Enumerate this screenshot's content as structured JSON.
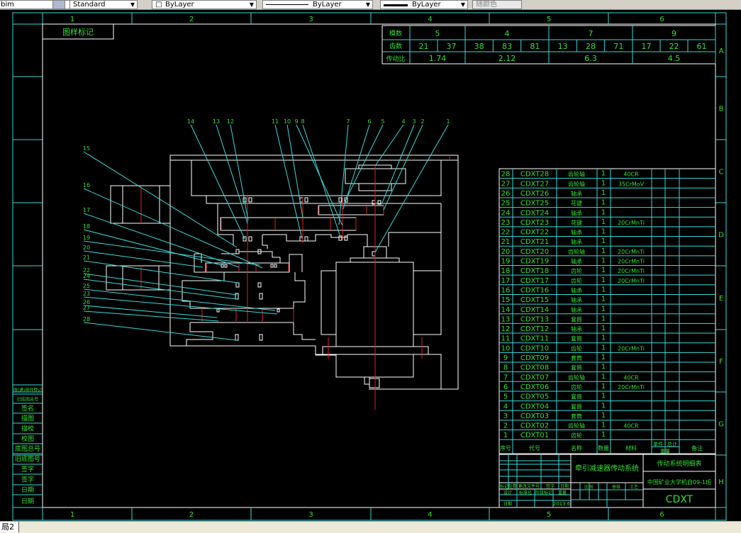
{
  "toolbar": {
    "dim_style": "bim",
    "text_style": "Standard",
    "layer_color": "ByLayer",
    "linetype": "ByLayer",
    "lineweight": "ByLayer",
    "plot_style": "随颜色"
  },
  "layout_tab": "局2",
  "colors": {
    "frame": "#38d8d8",
    "text": "#33e033",
    "geometry": "#ffffff",
    "centerline": "#e02020"
  },
  "border": {
    "columns": [
      "1",
      "2",
      "3",
      "4",
      "5",
      "6"
    ],
    "rows": [
      "A",
      "B",
      "C",
      "D",
      "E",
      "F",
      "G",
      "H"
    ],
    "top_left_label": "图样标记"
  },
  "gear_table": {
    "row_labels": [
      "模数",
      "齿数",
      "传动比"
    ],
    "groups": [
      {
        "module": "5",
        "teeth": [
          "21",
          "37"
        ],
        "ratio": "1.74"
      },
      {
        "module": "4",
        "teeth": [
          "38",
          "83",
          "81"
        ],
        "ratio": "2.12"
      },
      {
        "module": "7",
        "teeth": [
          "13",
          "28",
          "71"
        ],
        "ratio": "6.3"
      },
      {
        "module": "9",
        "teeth": [
          "17",
          "22",
          "61"
        ],
        "ratio": "4.5"
      }
    ]
  },
  "callouts_top": [
    "14",
    "13",
    "12",
    "11",
    "10",
    "9",
    "8",
    "7",
    "6",
    "5",
    "4",
    "3",
    "2",
    "1"
  ],
  "callouts_left": [
    "15",
    "16",
    "17",
    "18",
    "19",
    "20",
    "21",
    "22",
    "24",
    "25",
    "23",
    "26",
    "27",
    "28"
  ],
  "bom": {
    "headers": [
      "序号",
      "代号",
      "名称",
      "数量",
      "材料",
      "单件",
      "总计",
      "重量",
      "备注"
    ],
    "rows": [
      {
        "no": "28",
        "code": "CDXT28",
        "name": "齿轮轴",
        "qty": "1",
        "material": "40CR"
      },
      {
        "no": "27",
        "code": "CDXT27",
        "name": "齿轮轴",
        "qty": "1",
        "material": "35CrMoV"
      },
      {
        "no": "26",
        "code": "CDXT26",
        "name": "轴承",
        "qty": "1",
        "material": ""
      },
      {
        "no": "25",
        "code": "CDXT25",
        "name": "花键",
        "qty": "1",
        "material": ""
      },
      {
        "no": "24",
        "code": "CDXT24",
        "name": "轴承",
        "qty": "1",
        "material": ""
      },
      {
        "no": "23",
        "code": "CDXT23",
        "name": "花键",
        "qty": "1",
        "material": "20CrMnTi"
      },
      {
        "no": "22",
        "code": "CDXT22",
        "name": "轴承",
        "qty": "1",
        "material": ""
      },
      {
        "no": "21",
        "code": "CDXT21",
        "name": "轴承",
        "qty": "1",
        "material": ""
      },
      {
        "no": "20",
        "code": "CDXT20",
        "name": "齿轮轴",
        "qty": "1",
        "material": "20CrMnTi"
      },
      {
        "no": "19",
        "code": "CDXT19",
        "name": "轴承",
        "qty": "1",
        "material": "20CrMnTi"
      },
      {
        "no": "18",
        "code": "CDXT18",
        "name": "齿轮",
        "qty": "1",
        "material": "20CrMnTi"
      },
      {
        "no": "17",
        "code": "CDXT17",
        "name": "齿轮",
        "qty": "1",
        "material": "20CrMnTi"
      },
      {
        "no": "16",
        "code": "CDXT16",
        "name": "轴承",
        "qty": "1",
        "material": ""
      },
      {
        "no": "15",
        "code": "CDXT15",
        "name": "轴承",
        "qty": "1",
        "material": ""
      },
      {
        "no": "14",
        "code": "CDXT14",
        "name": "轴承",
        "qty": "1",
        "material": ""
      },
      {
        "no": "13",
        "code": "CDXT13",
        "name": "套筒",
        "qty": "1",
        "material": ""
      },
      {
        "no": "12",
        "code": "CDXT12",
        "name": "轴承",
        "qty": "1",
        "material": ""
      },
      {
        "no": "11",
        "code": "CDXT11",
        "name": "套筒",
        "qty": "1",
        "material": ""
      },
      {
        "no": "10",
        "code": "CDXT10",
        "name": "齿轮",
        "qty": "1",
        "material": "20CrMnTi"
      },
      {
        "no": "9",
        "code": "CDXT09",
        "name": "套筒",
        "qty": "1",
        "material": ""
      },
      {
        "no": "8",
        "code": "CDXT08",
        "name": "套筒",
        "qty": "1",
        "material": ""
      },
      {
        "no": "7",
        "code": "CDXT07",
        "name": "齿轮轴",
        "qty": "1",
        "material": "40CR"
      },
      {
        "no": "6",
        "code": "CDXT06",
        "name": "齿轮",
        "qty": "1",
        "material": "20CrMnTi"
      },
      {
        "no": "5",
        "code": "CDXT05",
        "name": "套筒",
        "qty": "1",
        "material": ""
      },
      {
        "no": "4",
        "code": "CDXT04",
        "name": "套筒",
        "qty": "1",
        "material": ""
      },
      {
        "no": "3",
        "code": "CDXT03",
        "name": "套筒",
        "qty": "1",
        "material": ""
      },
      {
        "no": "2",
        "code": "CDXT02",
        "name": "齿轮轴",
        "qty": "1",
        "material": "40CR"
      },
      {
        "no": "1",
        "code": "CDXT01",
        "name": "齿轮",
        "qty": "1",
        "material": ""
      }
    ]
  },
  "title_block": {
    "drawing_title": "牵引减速器传动系统",
    "sheet_title": "传动系统明细表",
    "organization": "中国矿业大学机自09-1班",
    "drawing_code": "CDXT",
    "date": "2013.6",
    "small_labels": [
      "标记",
      "处数",
      "更改文件号",
      "签字",
      "日期",
      "设计",
      "标准化",
      "阶段标记",
      "重量",
      "比例",
      "审核",
      "工艺",
      "日期"
    ]
  },
  "side_strip": [
    "借(通)用件登记",
    "旧底图总号",
    "签名",
    "描图",
    "描校",
    "校图",
    "底图总号",
    "旧底图号",
    "签字",
    "签字",
    "日期",
    "日期"
  ]
}
